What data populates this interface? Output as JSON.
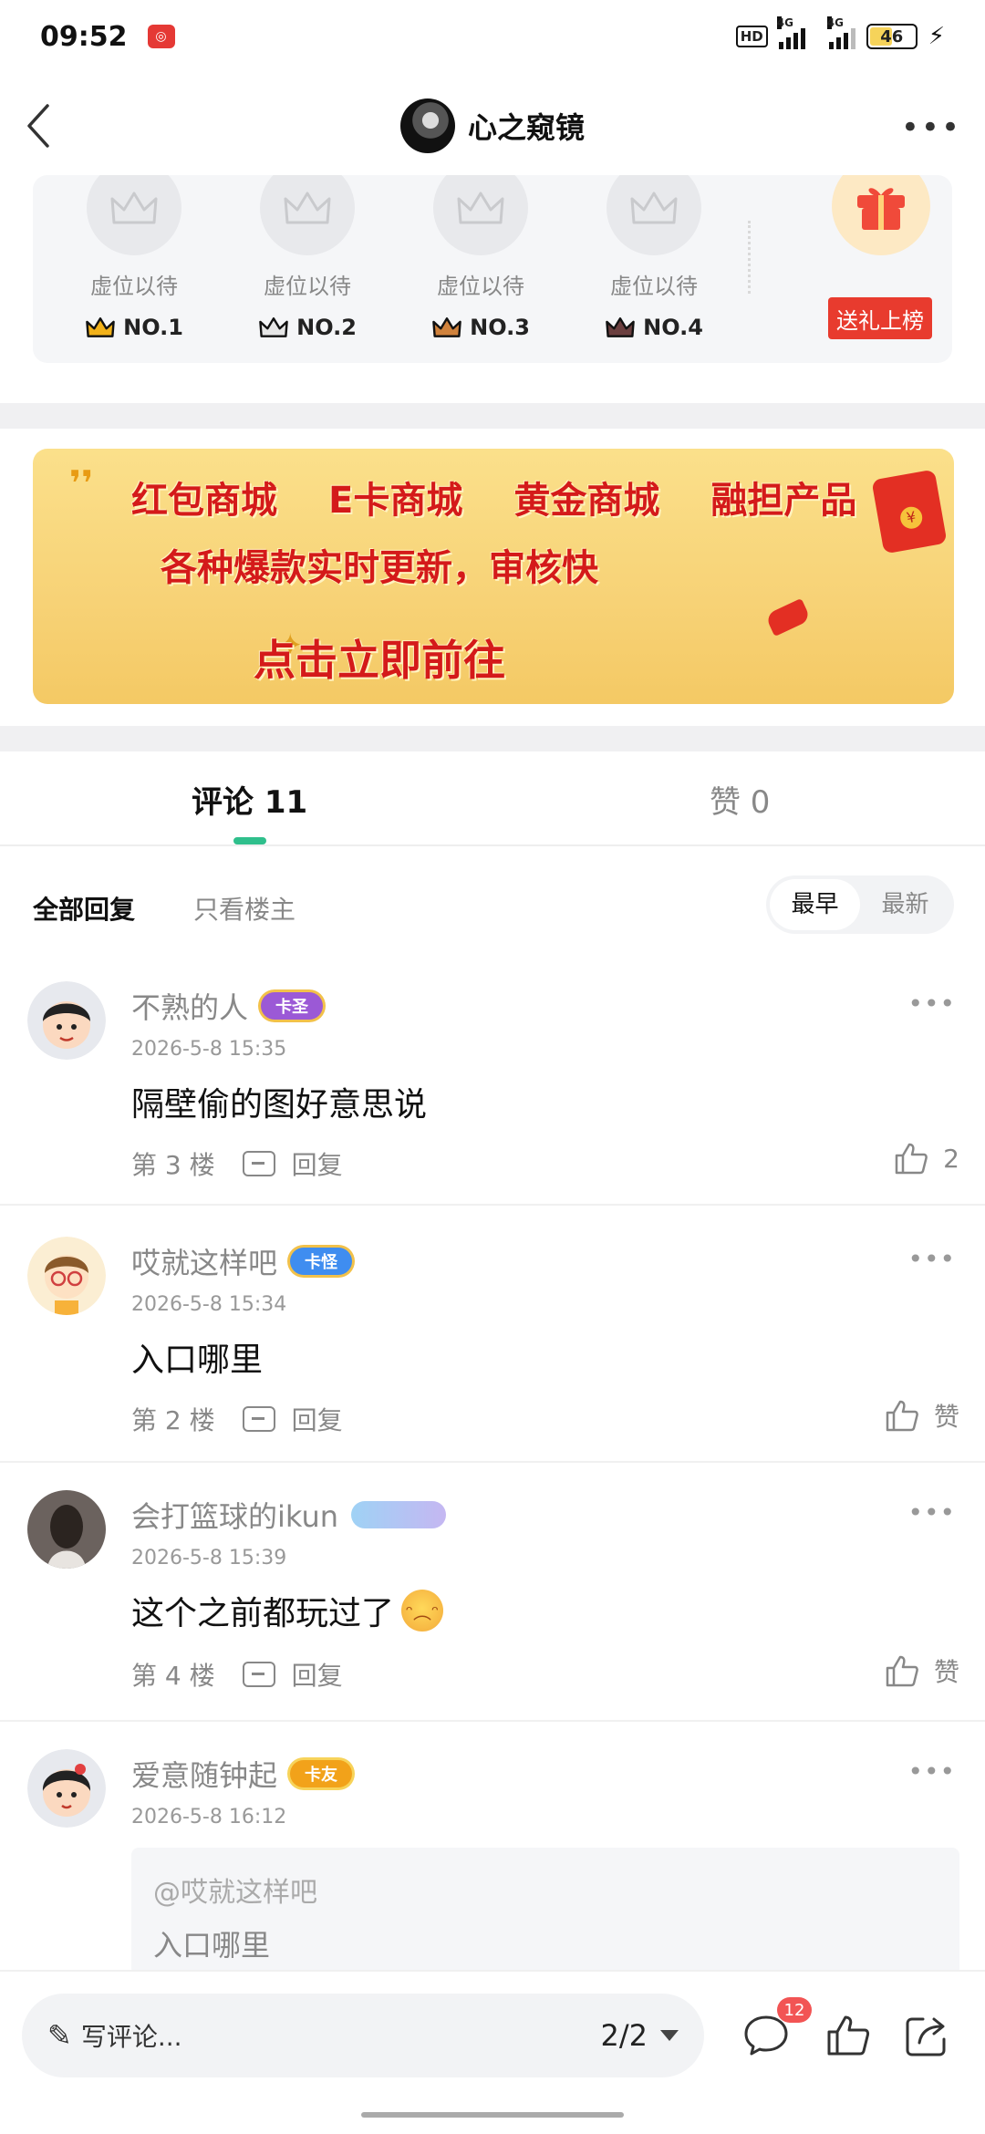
{
  "status_bar": {
    "time": "09:52",
    "hd": "HD",
    "net1": "4G",
    "net2": "4G",
    "battery": "46"
  },
  "nav": {
    "title": "心之窥镜"
  },
  "ranking": {
    "slots": [
      {
        "wait": "虚位以待",
        "rank": "NO.1",
        "crown_color": "#f2b21a"
      },
      {
        "wait": "虚位以待",
        "rank": "NO.2",
        "crown_color": "#7f7f7f"
      },
      {
        "wait": "虚位以待",
        "rank": "NO.3",
        "crown_color": "#d0823c"
      },
      {
        "wait": "虚位以待",
        "rank": "NO.4",
        "crown_color": "#6b3f3f"
      }
    ],
    "gift_button": "送礼上榜"
  },
  "banner": {
    "malls": [
      "红包商城",
      "E卡商城",
      "黄金商城",
      "融担产品"
    ],
    "line2": "各种爆款实时更新，审核快",
    "cta": "点击立即前往"
  },
  "tabs": {
    "comments": "评论 11",
    "likes": "赞 0"
  },
  "filter": {
    "all": "全部回复",
    "op_only": "只看楼主",
    "sort_earliest": "最早",
    "sort_newest": "最新"
  },
  "comments": [
    {
      "name": "不熟的人",
      "badge": "卡圣",
      "badge_color": "#9b59d6",
      "time": "2026-5-8 15:35",
      "text": "隔壁偷的图好意思说",
      "floor": "第 3 楼",
      "reply": "回复",
      "like": "2"
    },
    {
      "name": "哎就这样吧",
      "badge": "卡怪",
      "badge_color": "#3f8df0",
      "time": "2026-5-8 15:34",
      "text": "入口哪里",
      "floor": "第 2 楼",
      "reply": "回复",
      "like": "赞"
    },
    {
      "name": "会打篮球的ikun",
      "badge": "",
      "badge_color": "#8fc4f0",
      "time": "2026-5-8 15:39",
      "text": "这个之前都玩过了",
      "floor": "第 4 楼",
      "reply": "回复",
      "like": "赞"
    },
    {
      "name": "爱意随钟起",
      "badge": "卡友",
      "badge_color": "#f2a21a",
      "time": "2026-5-8 16:12",
      "quote_user": "@哎就这样吧",
      "quote_text": "入口哪里"
    }
  ],
  "bottom_bar": {
    "write_placeholder": "写评论...",
    "page": "2/2",
    "comment_count": "12"
  }
}
